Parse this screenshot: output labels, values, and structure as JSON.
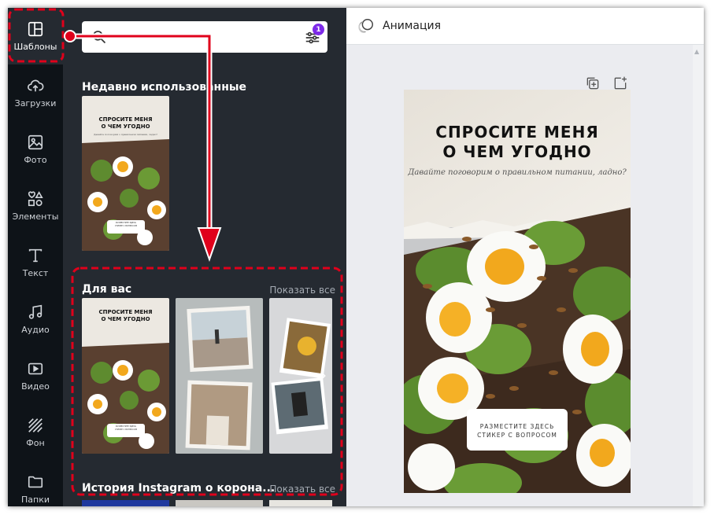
{
  "sidebar": {
    "items": [
      {
        "label": "Шаблоны",
        "icon": "templates-icon",
        "active": true
      },
      {
        "label": "Загрузки",
        "icon": "upload-cloud-icon"
      },
      {
        "label": "Фото",
        "icon": "photo-icon"
      },
      {
        "label": "Элементы",
        "icon": "elements-icon"
      },
      {
        "label": "Текст",
        "icon": "text-icon"
      },
      {
        "label": "Аудио",
        "icon": "music-note-icon"
      },
      {
        "label": "Видео",
        "icon": "video-icon"
      },
      {
        "label": "Фон",
        "icon": "background-pattern-icon"
      },
      {
        "label": "Папки",
        "icon": "folder-icon"
      }
    ]
  },
  "search": {
    "placeholder": "",
    "filter_badge": "1"
  },
  "sections": {
    "recent": {
      "title": "Недавно использованные"
    },
    "for_you": {
      "title": "Для вас",
      "show_all": "Показать все"
    },
    "instagram": {
      "title": "История Instagram о корона...",
      "show_all": "Показать все"
    }
  },
  "template": {
    "title_line1": "СПРОСИТЕ МЕНЯ",
    "title_line2": "О ЧЕМ УГОДНО",
    "subtitle": "Давайте поговорим о правильном питании, ладно?",
    "sticker_line1": "РАЗМЕСТИТЕ ЗДЕСЬ",
    "sticker_line2": "СТИКЕР С ВОПРОСОМ"
  },
  "toolbar": {
    "animation_label": "Анимация"
  },
  "colors": {
    "rail_bg": "#0e1318",
    "panel_bg": "#252a31",
    "accent_badge": "#7d2ae8",
    "annotation_red": "#e0001b"
  }
}
